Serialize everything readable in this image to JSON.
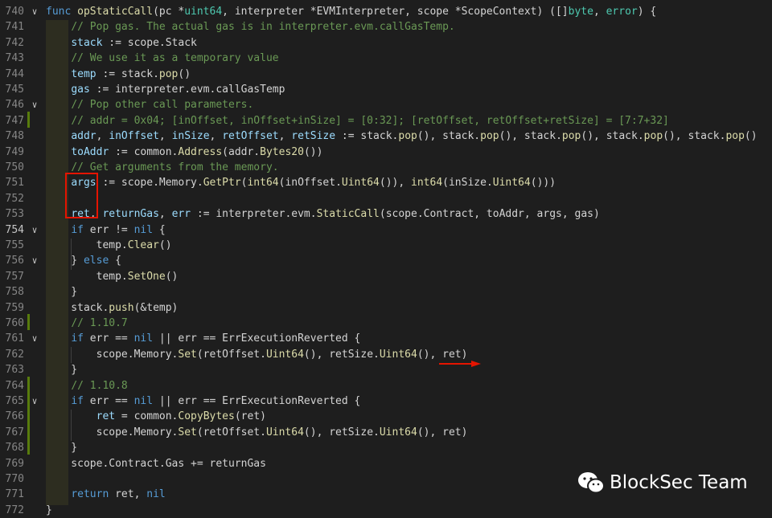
{
  "lines": [
    {
      "n": "740",
      "fold": "v",
      "tokens": [
        [
          "kw",
          "func "
        ],
        [
          "fn",
          "opStaticCall"
        ],
        [
          "op",
          "(pc "
        ],
        [
          "op",
          "*"
        ],
        [
          "typ",
          "uint64"
        ],
        [
          "op",
          ", interpreter *EVMInterpreter, scope *ScopeContext) ([]"
        ],
        [
          "typ",
          "byte"
        ],
        [
          "op",
          ", "
        ],
        [
          "typ",
          "error"
        ],
        [
          "op",
          ") {"
        ]
      ]
    },
    {
      "n": "741",
      "fold": "",
      "tokens": [
        [
          "op",
          "    "
        ],
        [
          "cm",
          "// Pop gas. The actual gas is in interpreter.evm.callGasTemp."
        ]
      ]
    },
    {
      "n": "742",
      "fold": "",
      "tokens": [
        [
          "op",
          "    "
        ],
        [
          "var",
          "stack"
        ],
        [
          "op",
          " := scope.Stack"
        ]
      ]
    },
    {
      "n": "743",
      "fold": "",
      "tokens": [
        [
          "op",
          "    "
        ],
        [
          "cm",
          "// We use it as a temporary value"
        ]
      ]
    },
    {
      "n": "744",
      "fold": "",
      "tokens": [
        [
          "op",
          "    "
        ],
        [
          "var",
          "temp"
        ],
        [
          "op",
          " := stack."
        ],
        [
          "fn",
          "pop"
        ],
        [
          "op",
          "()"
        ]
      ]
    },
    {
      "n": "745",
      "fold": "",
      "tokens": [
        [
          "op",
          "    "
        ],
        [
          "var",
          "gas"
        ],
        [
          "op",
          " := interpreter.evm.callGasTemp"
        ]
      ]
    },
    {
      "n": "746",
      "fold": "v",
      "tokens": [
        [
          "op",
          "    "
        ],
        [
          "cm",
          "// Pop other call parameters."
        ]
      ]
    },
    {
      "n": "747",
      "fold": "",
      "tokens": [
        [
          "op",
          "    "
        ],
        [
          "cm",
          "// addr = 0x04; [inOffset, inOffset+inSize] = [0:32]; [retOffset, retOffset+retSize] = [7:7+32]"
        ]
      ]
    },
    {
      "n": "748",
      "fold": "",
      "tokens": [
        [
          "op",
          "    "
        ],
        [
          "var",
          "addr"
        ],
        [
          "op",
          ", "
        ],
        [
          "var",
          "inOffset"
        ],
        [
          "op",
          ", "
        ],
        [
          "var",
          "inSize"
        ],
        [
          "op",
          ", "
        ],
        [
          "var",
          "retOffset"
        ],
        [
          "op",
          ", "
        ],
        [
          "var",
          "retSize"
        ],
        [
          "op",
          " := stack."
        ],
        [
          "fn",
          "pop"
        ],
        [
          "op",
          "(), stack."
        ],
        [
          "fn",
          "pop"
        ],
        [
          "op",
          "(), stack."
        ],
        [
          "fn",
          "pop"
        ],
        [
          "op",
          "(), stack."
        ],
        [
          "fn",
          "pop"
        ],
        [
          "op",
          "(), stack."
        ],
        [
          "fn",
          "pop"
        ],
        [
          "op",
          "()"
        ]
      ]
    },
    {
      "n": "749",
      "fold": "",
      "tokens": [
        [
          "op",
          "    "
        ],
        [
          "var",
          "toAddr"
        ],
        [
          "op",
          " := common."
        ],
        [
          "fn",
          "Address"
        ],
        [
          "op",
          "(addr."
        ],
        [
          "fn",
          "Bytes20"
        ],
        [
          "op",
          "())"
        ]
      ]
    },
    {
      "n": "750",
      "fold": "",
      "tokens": [
        [
          "op",
          "    "
        ],
        [
          "cm",
          "// Get arguments from the memory."
        ]
      ]
    },
    {
      "n": "751",
      "fold": "",
      "tokens": [
        [
          "op",
          "    "
        ],
        [
          "var",
          "args"
        ],
        [
          "op",
          " := scope.Memory."
        ],
        [
          "fn",
          "GetPtr"
        ],
        [
          "op",
          "("
        ],
        [
          "fn",
          "int64"
        ],
        [
          "op",
          "(inOffset."
        ],
        [
          "fn",
          "Uint64"
        ],
        [
          "op",
          "()), "
        ],
        [
          "fn",
          "int64"
        ],
        [
          "op",
          "(inSize."
        ],
        [
          "fn",
          "Uint64"
        ],
        [
          "op",
          "()))"
        ]
      ]
    },
    {
      "n": "752",
      "fold": "",
      "tokens": []
    },
    {
      "n": "753",
      "fold": "",
      "tokens": [
        [
          "op",
          "    "
        ],
        [
          "var",
          "ret"
        ],
        [
          "op",
          ", "
        ],
        [
          "var",
          "returnGas"
        ],
        [
          "op",
          ", "
        ],
        [
          "var",
          "err"
        ],
        [
          "op",
          " := interpreter.evm."
        ],
        [
          "fn",
          "StaticCall"
        ],
        [
          "op",
          "(scope.Contract, toAddr, args, gas)"
        ]
      ]
    },
    {
      "n": "754",
      "fold": "v",
      "cur": true,
      "tokens": [
        [
          "op",
          "    "
        ],
        [
          "kw",
          "if"
        ],
        [
          "op",
          " err != "
        ],
        [
          "kw",
          "nil"
        ],
        [
          "op",
          " {"
        ]
      ]
    },
    {
      "n": "755",
      "fold": "",
      "tokens": [
        [
          "op",
          "        temp."
        ],
        [
          "fn",
          "Clear"
        ],
        [
          "op",
          "()"
        ]
      ]
    },
    {
      "n": "756",
      "fold": "v",
      "tokens": [
        [
          "op",
          "    } "
        ],
        [
          "kw",
          "else"
        ],
        [
          "op",
          " {"
        ]
      ]
    },
    {
      "n": "757",
      "fold": "",
      "tokens": [
        [
          "op",
          "        temp."
        ],
        [
          "fn",
          "SetOne"
        ],
        [
          "op",
          "()"
        ]
      ]
    },
    {
      "n": "758",
      "fold": "",
      "tokens": [
        [
          "op",
          "    }"
        ]
      ]
    },
    {
      "n": "759",
      "fold": "",
      "tokens": [
        [
          "op",
          "    stack."
        ],
        [
          "fn",
          "push"
        ],
        [
          "op",
          "(&temp)"
        ]
      ]
    },
    {
      "n": "760",
      "fold": "",
      "tokens": [
        [
          "op",
          "    "
        ],
        [
          "cm",
          "// 1.10.7"
        ]
      ]
    },
    {
      "n": "761",
      "fold": "v",
      "tokens": [
        [
          "op",
          "    "
        ],
        [
          "kw",
          "if"
        ],
        [
          "op",
          " err == "
        ],
        [
          "kw",
          "nil"
        ],
        [
          "op",
          " || err == ErrExecutionReverted {"
        ]
      ]
    },
    {
      "n": "762",
      "fold": "",
      "tokens": [
        [
          "op",
          "        scope.Memory."
        ],
        [
          "fn",
          "Set"
        ],
        [
          "op",
          "(retOffset."
        ],
        [
          "fn",
          "Uint64"
        ],
        [
          "op",
          "(), retSize."
        ],
        [
          "fn",
          "Uint64"
        ],
        [
          "op",
          "(), ret)"
        ]
      ]
    },
    {
      "n": "763",
      "fold": "",
      "tokens": [
        [
          "op",
          "    }"
        ]
      ]
    },
    {
      "n": "764",
      "fold": "",
      "tokens": [
        [
          "op",
          "    "
        ],
        [
          "cm",
          "// 1.10.8"
        ]
      ]
    },
    {
      "n": "765",
      "fold": "v",
      "tokens": [
        [
          "op",
          "    "
        ],
        [
          "kw",
          "if"
        ],
        [
          "op",
          " err == "
        ],
        [
          "kw",
          "nil"
        ],
        [
          "op",
          " || err == ErrExecutionReverted {"
        ]
      ]
    },
    {
      "n": "766",
      "fold": "",
      "tokens": [
        [
          "op",
          "        "
        ],
        [
          "var",
          "ret"
        ],
        [
          "op",
          " = common."
        ],
        [
          "fn",
          "CopyBytes"
        ],
        [
          "op",
          "(ret)"
        ]
      ]
    },
    {
      "n": "767",
      "fold": "",
      "tokens": [
        [
          "op",
          "        scope.Memory."
        ],
        [
          "fn",
          "Set"
        ],
        [
          "op",
          "(retOffset."
        ],
        [
          "fn",
          "Uint64"
        ],
        [
          "op",
          "(), retSize."
        ],
        [
          "fn",
          "Uint64"
        ],
        [
          "op",
          "(), ret)"
        ]
      ]
    },
    {
      "n": "768",
      "fold": "",
      "tokens": [
        [
          "op",
          "    }"
        ]
      ]
    },
    {
      "n": "769",
      "fold": "",
      "tokens": [
        [
          "op",
          "    scope.Contract.Gas += returnGas"
        ]
      ]
    },
    {
      "n": "770",
      "fold": "",
      "tokens": []
    },
    {
      "n": "771",
      "fold": "",
      "tokens": [
        [
          "op",
          "    "
        ],
        [
          "kw",
          "return"
        ],
        [
          "op",
          " ret, "
        ],
        [
          "kw",
          "nil"
        ]
      ]
    },
    {
      "n": "772",
      "fold": "",
      "tokens": [
        [
          "op",
          "}"
        ]
      ]
    }
  ],
  "colors": {
    "background": "#1e1e1e",
    "keyword": "#569cd6",
    "function": "#dcdcaa",
    "variable": "#9cdcfe",
    "type": "#4ec9b0",
    "comment": "#6a9955",
    "annotation": "#e51400"
  },
  "watermark": {
    "icon": "wechat-icon",
    "text": "BlockSec Team"
  }
}
